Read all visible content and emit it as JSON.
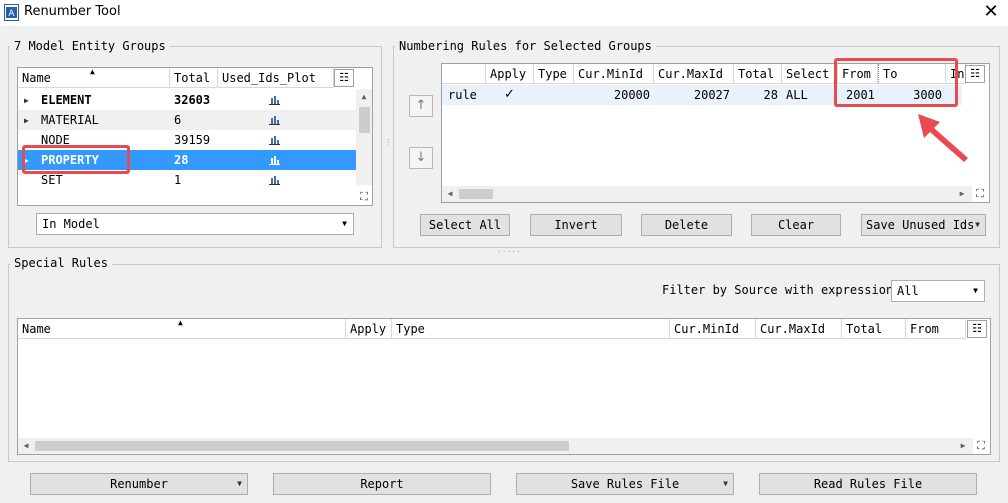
{
  "window": {
    "title": "Renumber Tool",
    "close_glyph": "✕",
    "icon": "renumber-app-icon"
  },
  "entity_groups": {
    "title": "7 Model Entity Groups",
    "columns": [
      "Name",
      "Total",
      "Used_Ids_Plot"
    ],
    "rows": [
      {
        "name": "ELEMENT",
        "total": "32603",
        "expandable": true,
        "bold": true
      },
      {
        "name": "MATERIAL",
        "total": "6",
        "expandable": true,
        "bold": false
      },
      {
        "name": "NODE",
        "total": "39159",
        "expandable": false,
        "bold": false
      },
      {
        "name": "PROPERTY",
        "total": "28",
        "expandable": true,
        "bold": true,
        "selected": true
      },
      {
        "name": "SET",
        "total": "1",
        "expandable": false,
        "bold": false
      }
    ],
    "scope_combo": "In Model"
  },
  "numbering_rules": {
    "title": "Numbering Rules for Selected Groups",
    "columns": [
      "",
      "Apply",
      "Type",
      "Cur.MinId",
      "Cur.MaxId",
      "Total",
      "Select",
      "From",
      "To",
      "In"
    ],
    "rows": [
      {
        "name": "rule",
        "apply": "✓",
        "type": "",
        "cur_min": "20000",
        "cur_max": "20027",
        "total": "28",
        "select": "ALL",
        "from": "2001",
        "to": "3000"
      }
    ],
    "buttons": {
      "select_all": "Select All",
      "invert": "Invert",
      "delete": "Delete",
      "clear": "Clear",
      "save_unused": "Save Unused Ids"
    },
    "move_up": "↑",
    "move_down": "↓"
  },
  "special_rules": {
    "title": "Special Rules",
    "filter_label": "Filter by Source with expression",
    "filter_value": "All",
    "columns": [
      "Name",
      "Apply",
      "Type",
      "Cur.MinId",
      "Cur.MaxId",
      "Total",
      "From"
    ]
  },
  "bottom_buttons": {
    "renumber": "Renumber",
    "report": "Report",
    "save_rules": "Save Rules File",
    "read_rules": "Read Rules File"
  },
  "colors": {
    "selection": "#3399ff",
    "highlight": "#e84a4f",
    "panel": "#f0f0f0"
  }
}
